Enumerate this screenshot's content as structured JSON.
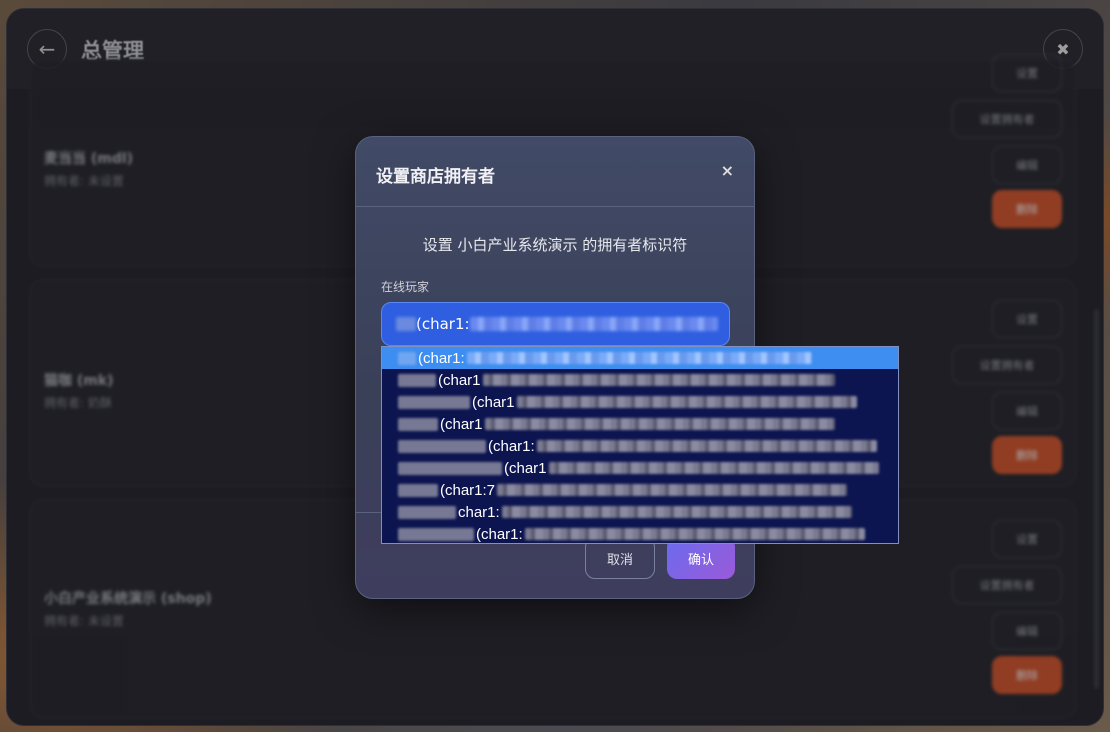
{
  "header": {
    "title": "总管理",
    "back_icon": "←",
    "close_icon": "✖"
  },
  "shops": [
    {
      "name": "麦当当 (mdl)",
      "owner": "拥有者: 未设置",
      "buttons": [
        "设置",
        "设置拥有者",
        "编辑",
        "删除"
      ]
    },
    {
      "name": "猫咖 (mk)",
      "owner": "拥有者: 奶酥",
      "buttons": [
        "设置",
        "设置拥有者",
        "编辑",
        "删除"
      ]
    },
    {
      "name": "小白产业系统演示 (shop)",
      "owner": "拥有者: 未设置",
      "buttons": [
        "设置",
        "设置拥有者",
        "编辑",
        "删除"
      ]
    }
  ],
  "modal": {
    "title": "设置商店拥有者",
    "close_icon": "×",
    "description": "设置 小白产业系统演示 的拥有者标识符",
    "field_label": "在线玩家",
    "selected_value": "(char1:",
    "cancel_label": "取消",
    "confirm_label": "确认"
  },
  "dropdown": {
    "options": [
      "(char1:",
      "(char1",
      "(char1",
      "(char1",
      "(char1:",
      "(char1",
      "(char1:7",
      "char1:",
      "(char1:"
    ]
  },
  "colors": {
    "accent_blue": "#2f5fe0",
    "selected_option": "#3d8ef0",
    "delete_button": "#d8552a",
    "confirm_gradient_start": "#6b6bef",
    "confirm_gradient_end": "#9a5ad8"
  }
}
